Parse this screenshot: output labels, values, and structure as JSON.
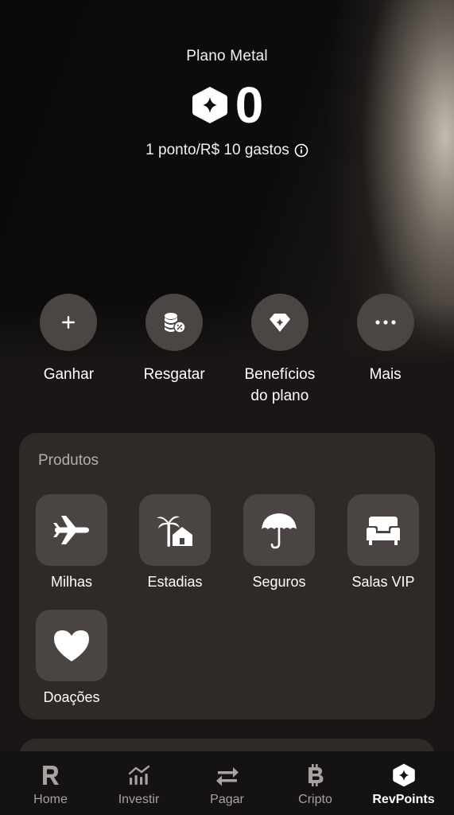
{
  "hero": {
    "plan_name": "Plano Metal",
    "points": "0",
    "rate_text": "1 ponto/R$ 10 gastos"
  },
  "actions": [
    {
      "label": "Ganhar",
      "icon": "plus-icon"
    },
    {
      "label": "Resgatar",
      "icon": "coins-percent-icon"
    },
    {
      "label": "Benefícios\ndo plano",
      "icon": "diamond-icon"
    },
    {
      "label": "Mais",
      "icon": "more-dots-icon"
    }
  ],
  "products": {
    "title": "Produtos",
    "items": [
      {
        "label": "Milhas",
        "icon": "airplane-icon"
      },
      {
        "label": "Estadias",
        "icon": "palm-house-icon"
      },
      {
        "label": "Seguros",
        "icon": "umbrella-icon"
      },
      {
        "label": "Salas VIP",
        "icon": "armchair-icon"
      },
      {
        "label": "Doações",
        "icon": "heart-icon"
      }
    ]
  },
  "tabbar": {
    "items": [
      {
        "label": "Home",
        "icon": "revolut-r-icon",
        "active": false
      },
      {
        "label": "Investir",
        "icon": "bar-chart-icon",
        "active": false
      },
      {
        "label": "Pagar",
        "icon": "transfer-arrows-icon",
        "active": false
      },
      {
        "label": "Cripto",
        "icon": "bitcoin-icon",
        "active": false
      },
      {
        "label": "RevPoints",
        "icon": "revpoints-icon",
        "active": true
      }
    ]
  },
  "colors": {
    "accent_white": "#ffffff",
    "card_bg": "#2e2a28",
    "tile_bg": "#4a4542",
    "muted_text": "#b5afaa"
  }
}
